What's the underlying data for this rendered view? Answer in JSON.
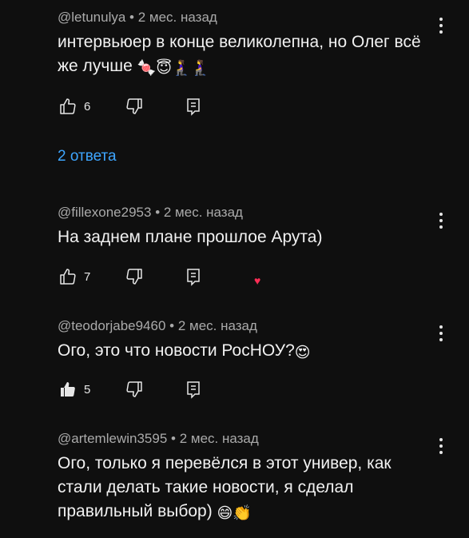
{
  "comments": [
    {
      "author": "@letunulya",
      "age": "2 мес. назад",
      "text": "интервьюер в конце великолепна, но Олег всё же лучше",
      "emojis": "🍬😇🧎‍♀️🧎‍♀️",
      "likes": "6",
      "liked": false
    },
    {
      "author": "@fillexone2953",
      "age": "2 мес. назад",
      "text": "На заднем плане прошлое Арута)",
      "emojis": "",
      "likes": "7",
      "liked": false,
      "creator_heart": "♥"
    },
    {
      "author": "@teodorjabe9460",
      "age": "2 мес. назад",
      "text": "Ого, это что новости РосНОУ?",
      "emojis": "😍",
      "likes": "5",
      "liked": true
    },
    {
      "author": "@artemlewin3595",
      "age": "2 мес. назад",
      "text": "Ого, только я перевёлся в этот универ, как стали делать такие новости, я сделал правильный выбор)",
      "emojis": "😄👏",
      "likes": "",
      "liked": false
    }
  ],
  "replies_link": "2 ответа",
  "meta_separator": "•",
  "colors": {
    "background": "#0f0f0f",
    "text": "#f1f1f1",
    "meta": "#aaaaaa",
    "link": "#3ea6ff",
    "heart": "#ff2d55"
  },
  "icons": [
    "like-icon",
    "dislike-icon",
    "reply-icon",
    "more-options-icon",
    "creator-heart-icon"
  ]
}
